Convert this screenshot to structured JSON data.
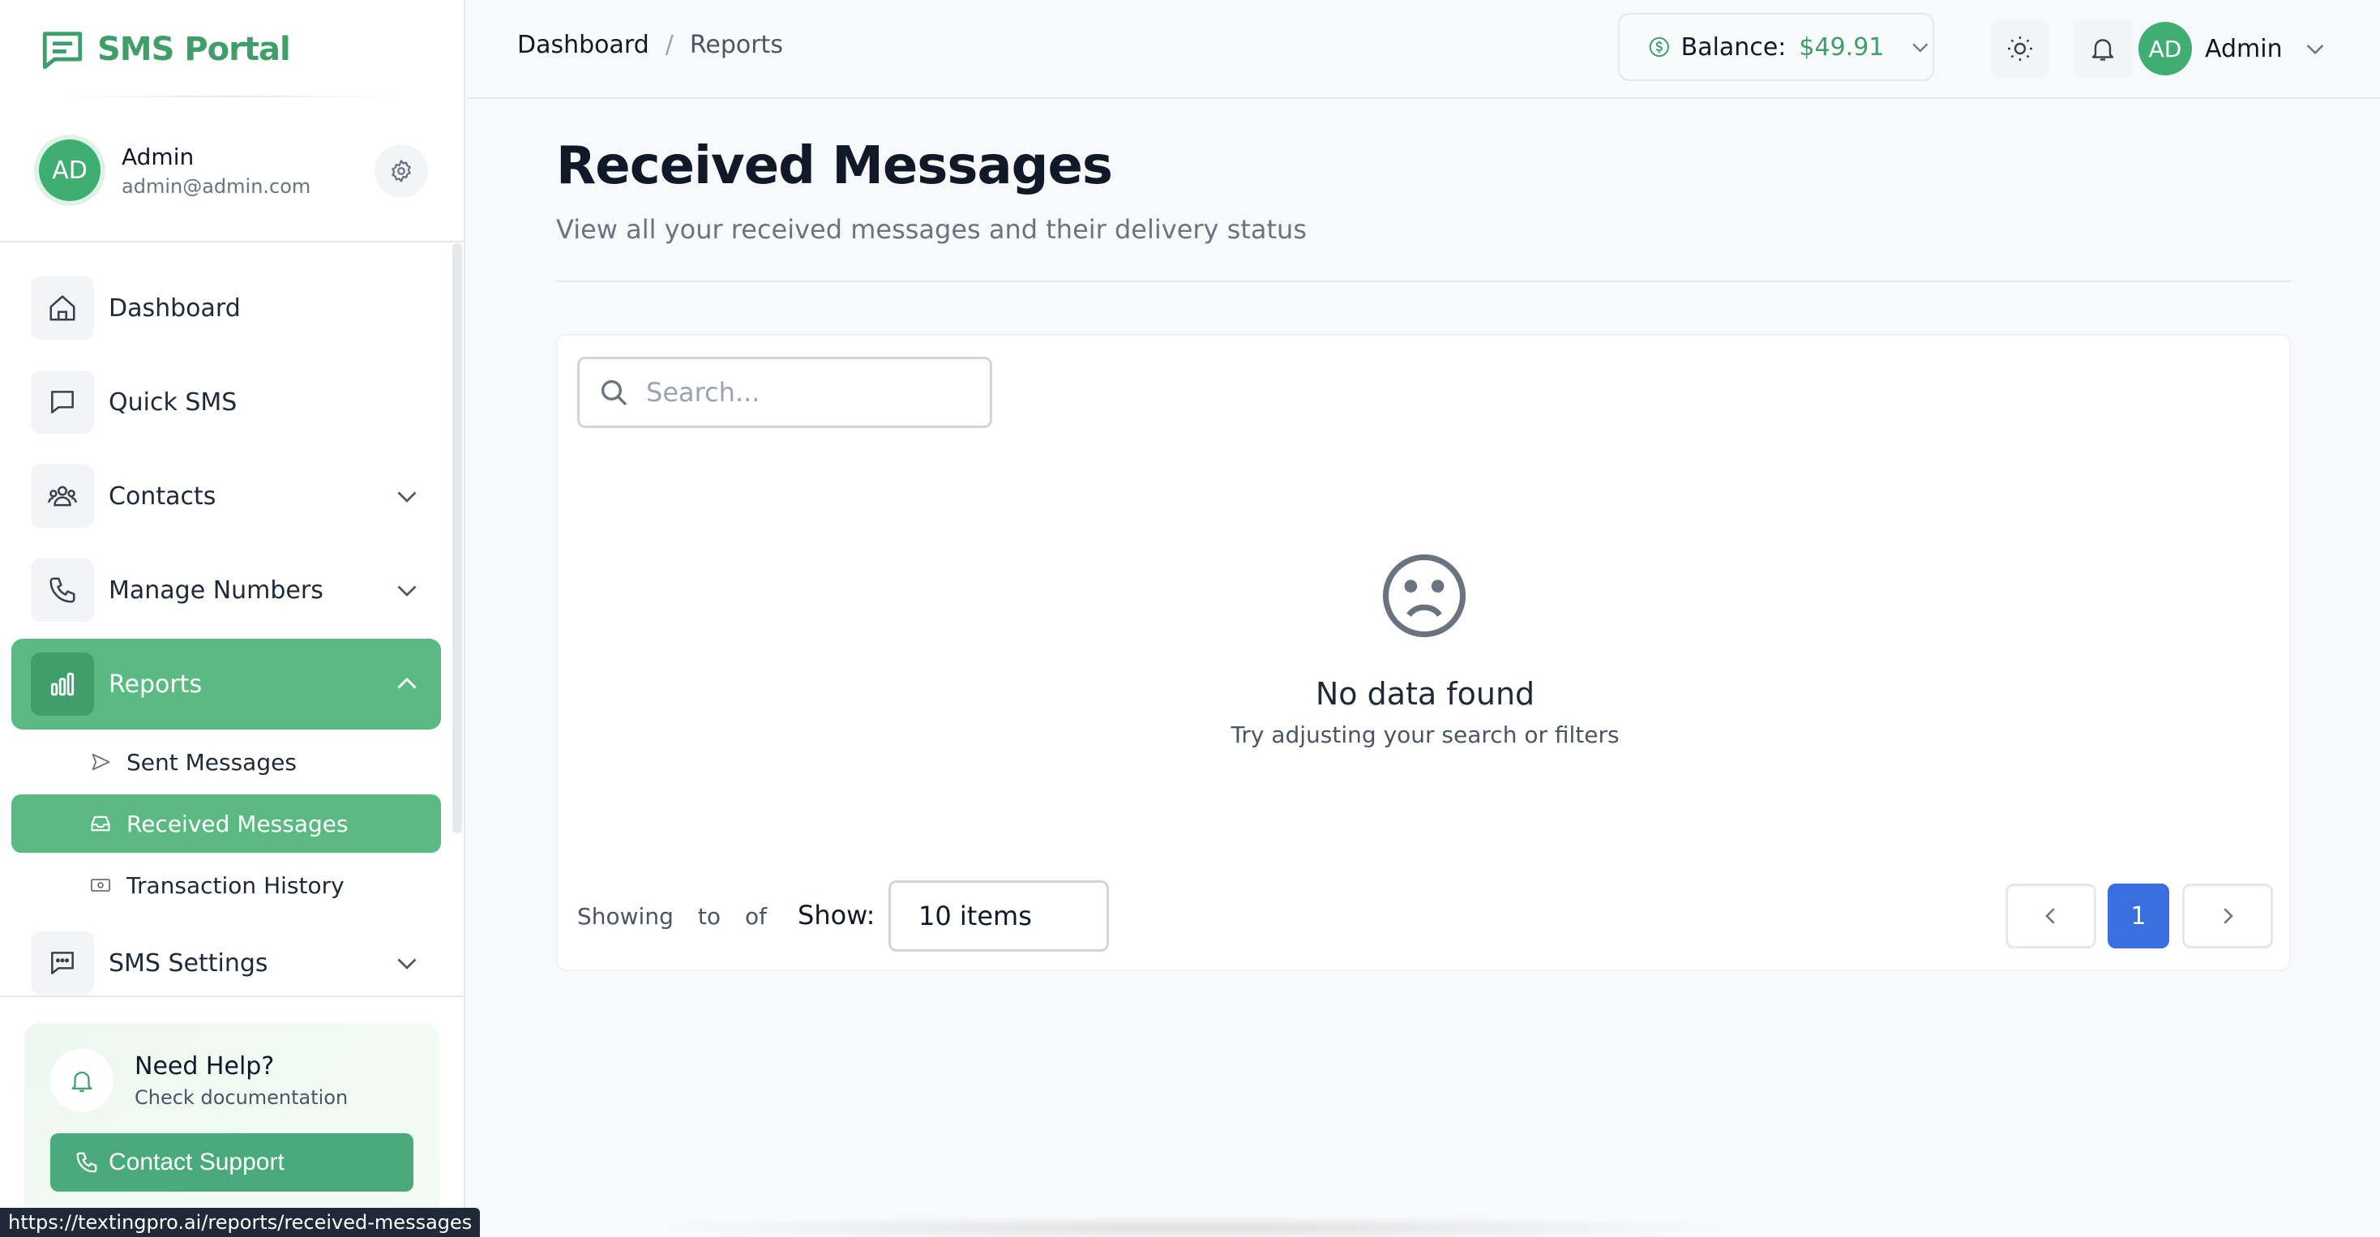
{
  "app": {
    "name": "SMS Portal"
  },
  "profile": {
    "initials": "AD",
    "name": "Admin",
    "email": "admin@admin.com"
  },
  "nav": {
    "dashboard": "Dashboard",
    "quick_sms": "Quick SMS",
    "contacts": "Contacts",
    "manage_numbers": "Manage Numbers",
    "reports": "Reports",
    "sms_settings": "SMS Settings",
    "reports_sub": {
      "sent": "Sent Messages",
      "received": "Received Messages",
      "transactions": "Transaction History"
    }
  },
  "help": {
    "title": "Need Help?",
    "subtitle": "Check documentation",
    "button": "Contact Support"
  },
  "status_bar": {
    "url": "https://textingpro.ai/reports/received-messages"
  },
  "header": {
    "breadcrumb": {
      "home": "Dashboard",
      "separator": "/",
      "current": "Reports"
    },
    "balance_label": "Balance:",
    "balance_value": "$49.91",
    "user_initials": "AD",
    "user_name": "Admin"
  },
  "page": {
    "title": "Received Messages",
    "subtitle": "View all your received messages and their delivery status"
  },
  "table": {
    "search_placeholder": "Search...",
    "empty_title": "No data found",
    "empty_subtitle": "Try adjusting your search or filters",
    "showing": "Showing",
    "to": "to",
    "of": "of",
    "show_label": "Show:",
    "page_size": "10 items",
    "current_page": "1"
  },
  "colors": {
    "brand": "#3f9e6a",
    "active_nav": "#5aba81",
    "pagination_active": "#3b6fe0"
  },
  "icons": {
    "logo": "chat-square-icon",
    "settings": "gear-icon",
    "dashboard": "home-icon",
    "quick_sms": "chat-bubble-icon",
    "contacts": "users-icon",
    "manage_numbers": "phone-icon",
    "reports": "bar-chart-icon",
    "sms_settings": "message-dots-icon",
    "sent": "send-icon",
    "received": "inbox-icon",
    "transactions": "cash-icon",
    "empty": "sad-face-icon"
  }
}
